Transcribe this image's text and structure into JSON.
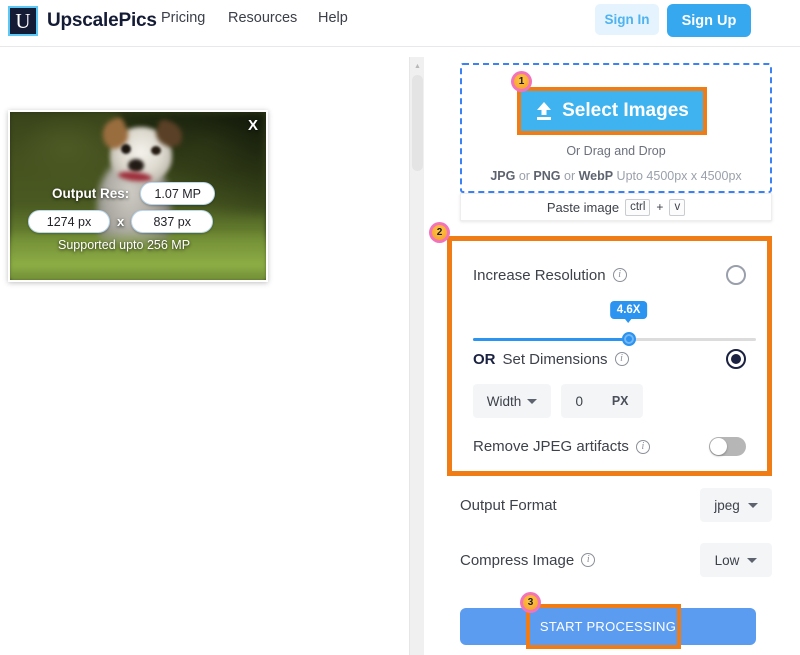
{
  "header": {
    "brand_name": "UpscalePics",
    "logo_letter": "U",
    "nav": [
      {
        "label": "Pricing"
      },
      {
        "label": "Resources"
      },
      {
        "label": "Help"
      }
    ],
    "sign_in_label": "Sign In",
    "sign_up_label": "Sign Up",
    "accent_blue": "#35a8f0",
    "signin_bg": "#e4f3fd",
    "logo_bg": "#141b35",
    "logo_border": "#5bc8f5"
  },
  "preview": {
    "close_label": "X",
    "output_res_label": "Output Res:",
    "megapixels": "1.07 MP",
    "width_px": "1274 px",
    "times_symbol": "x",
    "height_px": "837 px",
    "supported_note": "Supported upto 256 MP"
  },
  "dropzone": {
    "select_button_label": "Select Images",
    "upload_icon": "upload-arrow-icon",
    "drag_text": "Or Drag and Drop",
    "format_prefix_jpg": "JPG",
    "format_or_1": " or ",
    "format_png": "PNG",
    "format_or_2": " or ",
    "format_webp": "WebP",
    "format_suffix": " Upto 4500px x 4500px",
    "paste_label": "Paste image",
    "key_ctrl": "ctrl",
    "key_plus": "+",
    "key_v": "v",
    "border_color": "#3b82f6",
    "button_bg": "#3fb3ef"
  },
  "settings": {
    "highlight_color": "#f07c16",
    "increase_resolution": {
      "label": "Increase Resolution",
      "info_icon": "info-icon",
      "selected": false,
      "slider_value": "4.6X",
      "slider_percent": 55,
      "slider_fill_color": "#2b93f0"
    },
    "set_dimensions": {
      "label_bold": "OR",
      "label_rest": " Set Dimensions",
      "info_icon": "info-icon",
      "selected": true,
      "dimension_select_value": "Width",
      "dimension_value": "0",
      "dimension_unit": "PX"
    },
    "remove_jpeg": {
      "label": "Remove JPEG artifacts",
      "info_icon": "info-icon",
      "enabled": false
    }
  },
  "output": {
    "format_label": "Output Format",
    "format_value": "jpeg",
    "compress_label": "Compress Image",
    "compress_info_icon": "info-icon",
    "compress_value": "Low"
  },
  "action": {
    "start_label": "START PROCESSING",
    "button_color": "#5b9cf0"
  },
  "badges": {
    "one": "1",
    "two": "2",
    "three": "3",
    "ring_color": "#f373b8",
    "inner_color": "#f59a20"
  },
  "scrollbar": {
    "arrow_icon": "scroll-up-arrow-icon"
  }
}
